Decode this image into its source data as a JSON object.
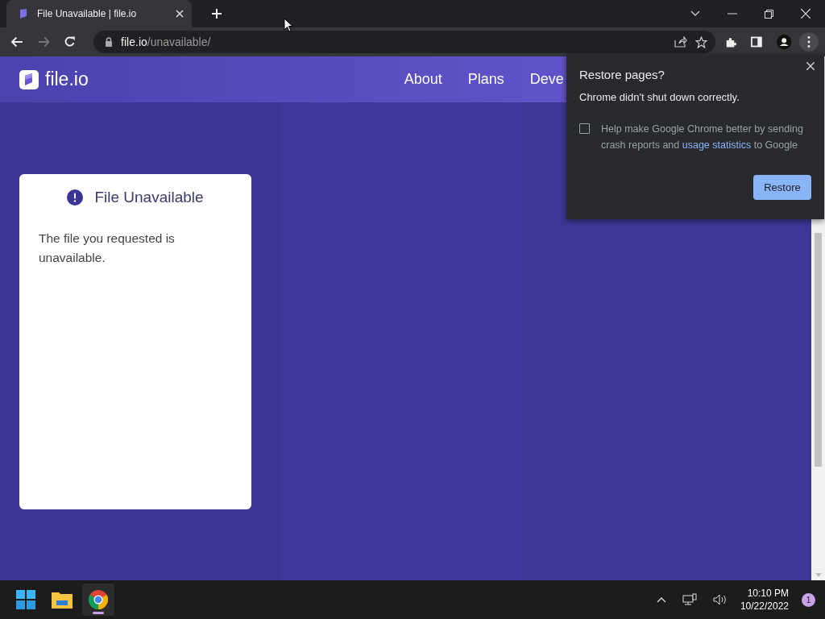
{
  "tabs": [
    {
      "title": "File Unavailable | file.io",
      "selected": true
    }
  ],
  "address": {
    "host": "file.io",
    "path": "/unavailable/"
  },
  "site": {
    "logo_text": "file.io",
    "nav": [
      "About",
      "Plans",
      "Deve"
    ]
  },
  "card": {
    "title": "File Unavailable",
    "message": "The file you requested is unavailable."
  },
  "popup": {
    "title": "Restore pages?",
    "message": "Chrome didn't shut down correctly.",
    "checkbox": {
      "checked": false,
      "text_before": "Help make Google Chrome better by sending crash reports and",
      "link": "usage statistics",
      "text_after": "to Google"
    },
    "button": "Restore"
  },
  "taskbar": {
    "time": "10:10 PM",
    "date": "10/22/2022",
    "notifications": "1"
  }
}
